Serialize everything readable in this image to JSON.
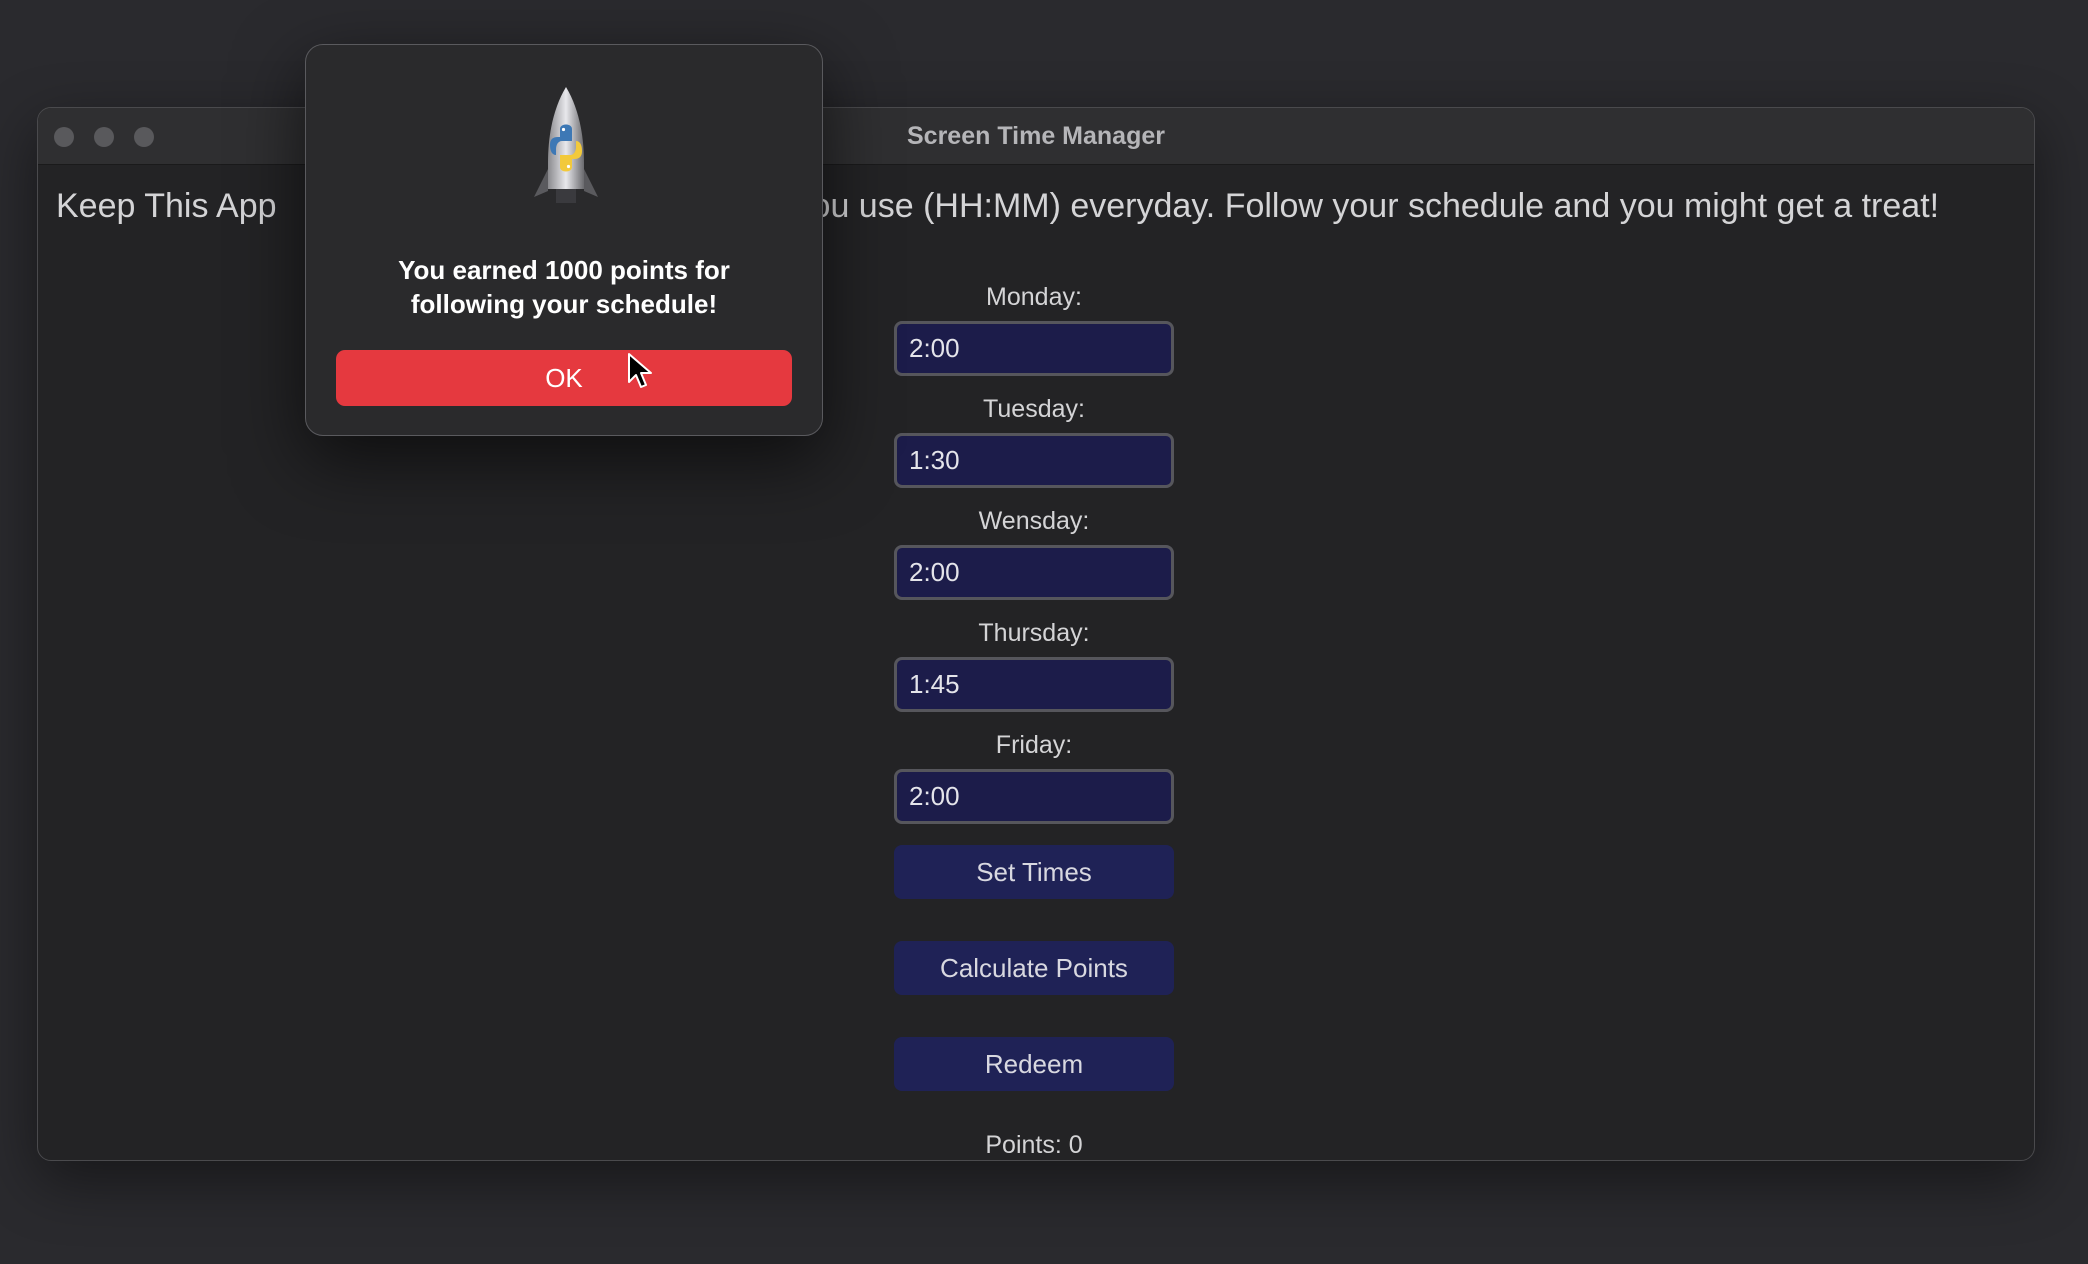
{
  "window": {
    "title": "Screen Time Manager",
    "instructions": "Keep This App Open And Input The Amount Of Time You Want To Spend You use (HH:MM) everyday. Follow your schedule and you might get a treat!",
    "instructions_visible": "Keep This App                                                    ou use (HH:MM) everyday. Follow your schedule and you might get a treat!"
  },
  "schedule": {
    "monday_label": "Monday:",
    "monday_value": "2:00",
    "tuesday_label": "Tuesday:",
    "tuesday_value": "1:30",
    "wednesday_label": "Wensday:",
    "wednesday_value": "2:00",
    "thursday_label": "Thursday:",
    "thursday_value": "1:45",
    "friday_label": "Friday:",
    "friday_value": "2:00"
  },
  "actions": {
    "set_times": "Set Times",
    "calculate_points": "Calculate Points",
    "redeem": "Redeem"
  },
  "points_label": "Points: 0",
  "alert": {
    "message_line1": "You earned 1000 points for",
    "message_line2": "following your schedule!",
    "ok_label": "OK",
    "icon": "python-rocket-icon"
  },
  "colors": {
    "ok_button": "#e5393f",
    "input_bg": "#1c1c4a",
    "button_bg": "#1f2256"
  }
}
